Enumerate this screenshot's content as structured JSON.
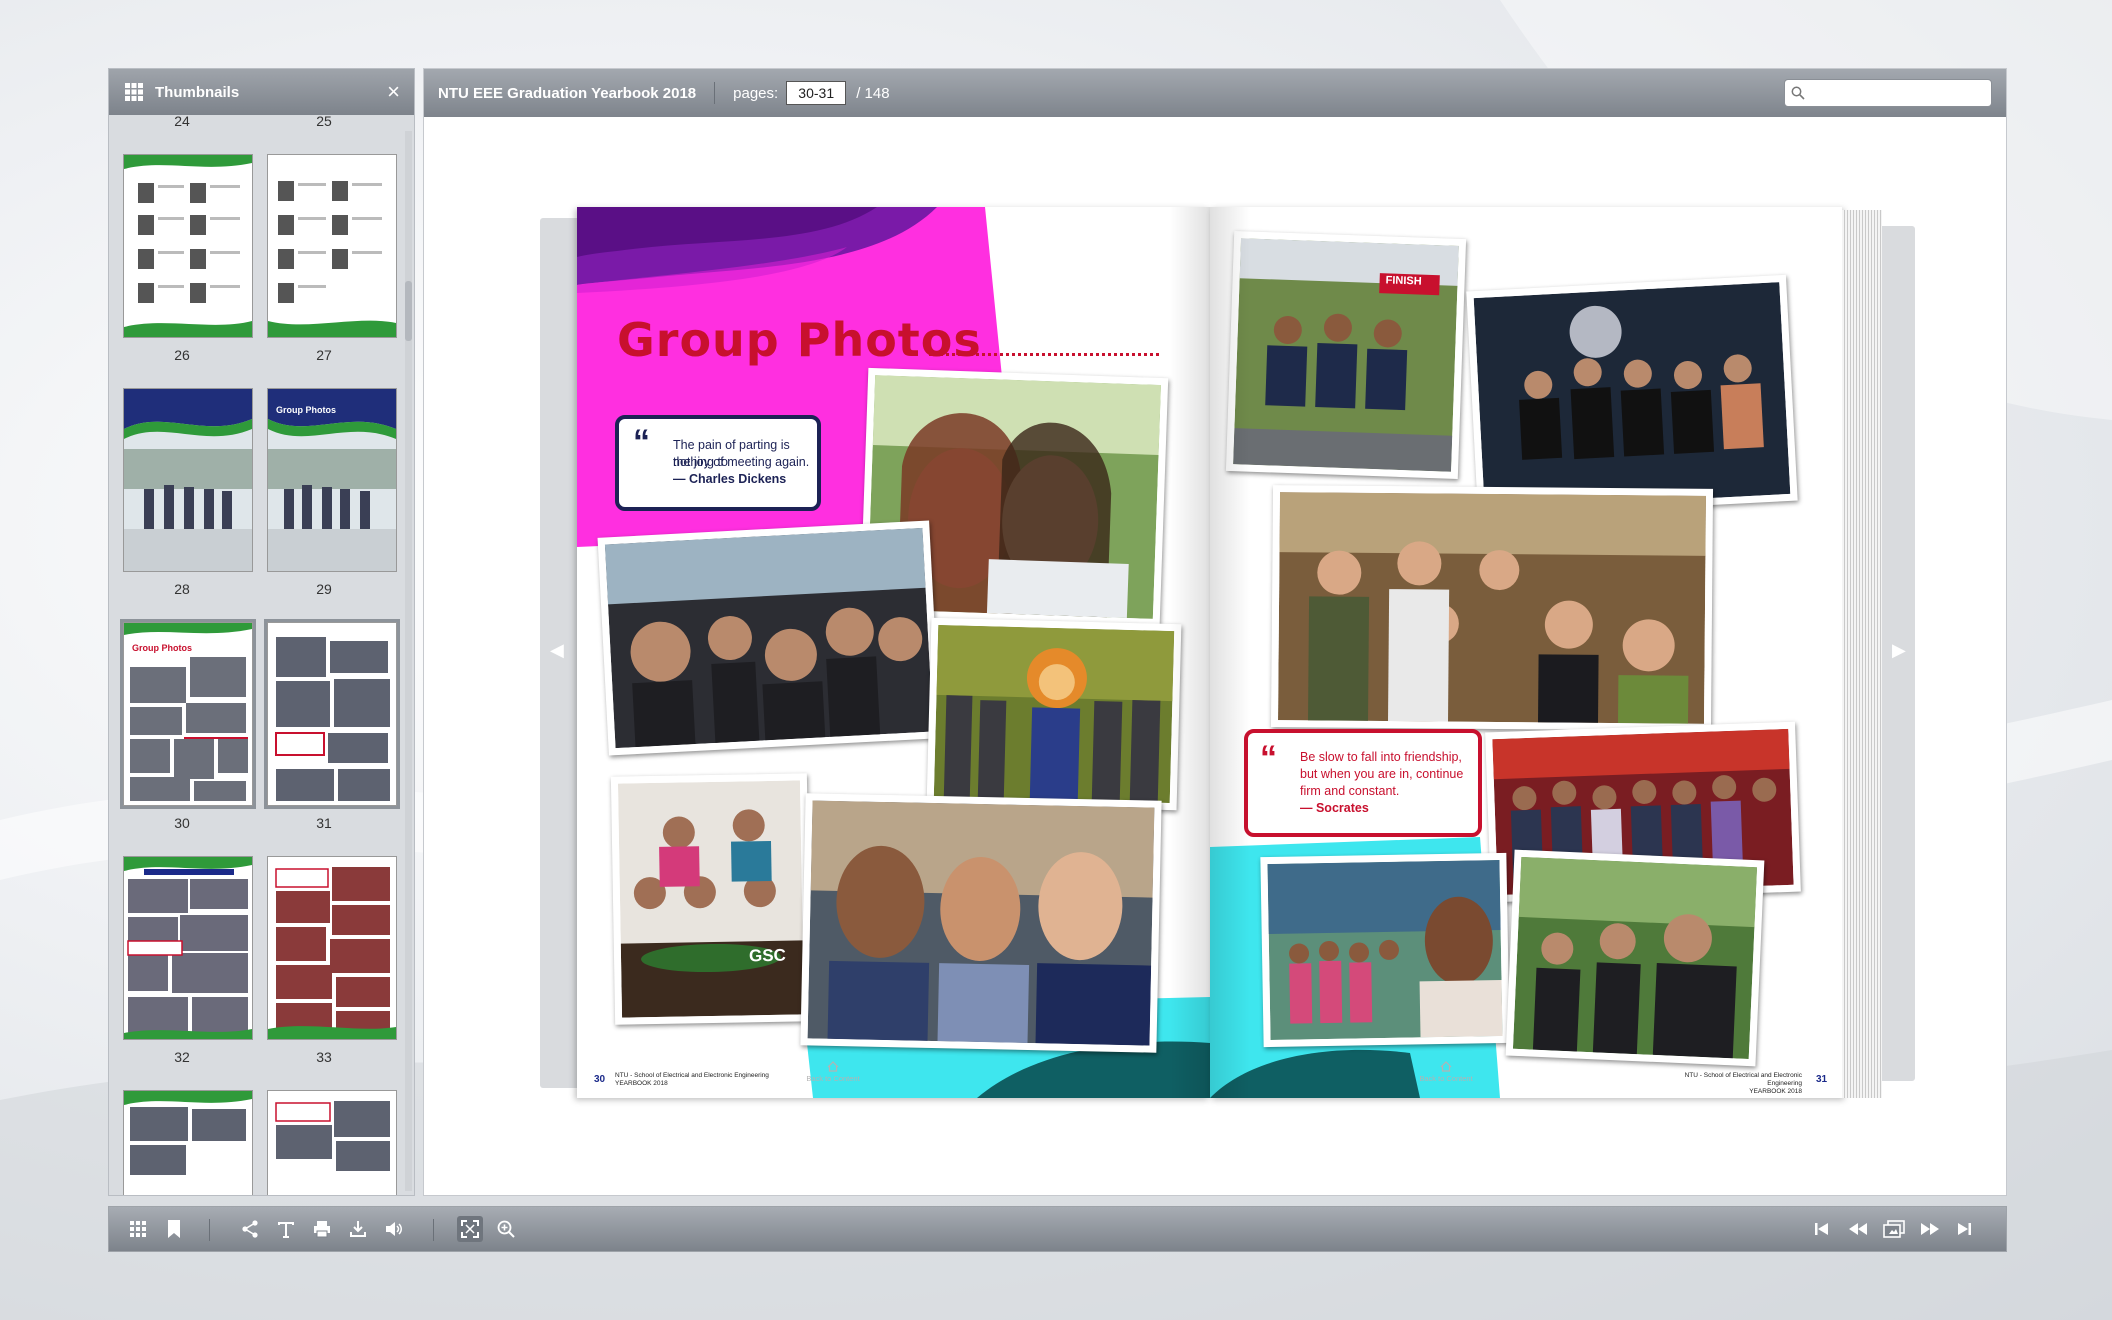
{
  "thumbnails": {
    "title": "Thumbnails",
    "close_label": "×",
    "rows": [
      {
        "left": "24",
        "right": "25"
      },
      {
        "left": "26",
        "right": "27"
      },
      {
        "left": "28",
        "right": "29"
      },
      {
        "left": "30",
        "right": "31"
      },
      {
        "left": "32",
        "right": "33"
      }
    ],
    "mini_heading_28": "Group Photos",
    "mini_heading_27": "Group Photos"
  },
  "viewer": {
    "title": "NTU EEE Graduation Yearbook 2018",
    "pages_label": "pages:",
    "pages_value": "30-31",
    "pages_total": "/ 148",
    "search_placeholder": ""
  },
  "spread": {
    "heading": "Group Photos",
    "quote_left": {
      "mark": "“",
      "text_line1": "The pain of parting is nothing to",
      "text_line2": "the joy of meeting again.",
      "author": "— Charles Dickens"
    },
    "quote_right": {
      "mark": "“",
      "text_line1": "Be slow to fall into friendship,",
      "text_line2": "but when you are in, continue",
      "text_line3": "firm and constant.",
      "author": "— Socrates"
    },
    "photo_sign": "FINISH",
    "tshirt_text": "GSC",
    "left_page_number": "30",
    "right_page_number": "31",
    "school_line1": "NTU - School of Electrical and Electronic Engineering",
    "school_line2": "YEARBOOK 2018",
    "back_to_content": "Back to Content"
  },
  "colors": {
    "accent_red": "#c8102e",
    "magenta": "#ff2fe0",
    "cyan": "#3ee6ee",
    "navy": "#1c2255"
  },
  "toolbar": {
    "left_icons": [
      "grid-icon",
      "bookmark-icon",
      "share-icon",
      "text-icon",
      "print-icon",
      "download-icon",
      "sound-icon",
      "fullscreen-icon",
      "zoom-in-icon"
    ],
    "right_icons": [
      "first-page-icon",
      "previous-page-icon",
      "page-view-icon",
      "next-page-icon",
      "last-page-icon"
    ]
  }
}
